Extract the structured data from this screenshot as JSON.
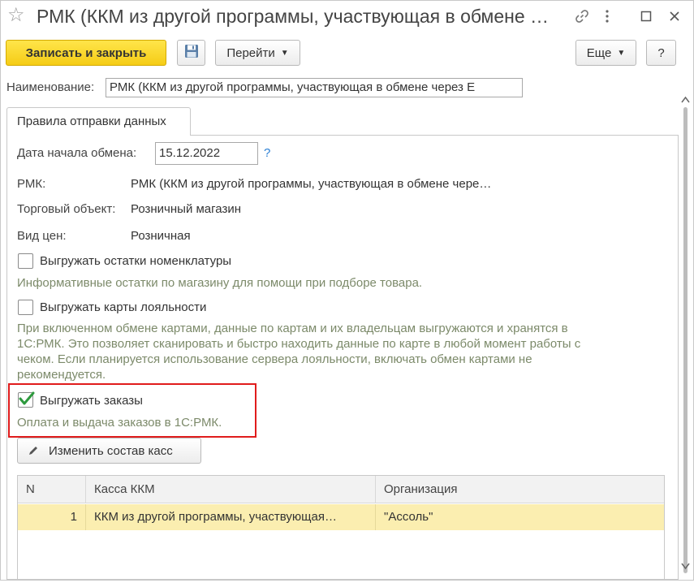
{
  "window": {
    "title": "РМК (ККМ из другой программы, участвующая в обмене ча…"
  },
  "toolbar": {
    "save_close_label": "Записать и закрыть",
    "goto_label": "Перейти",
    "more_label": "Еще",
    "help_label": "?"
  },
  "name_field": {
    "label": "Наименование:",
    "value": "РМК (ККМ из другой программы, участвующая в обмене через Е"
  },
  "tabs": [
    {
      "label": "Правила отправки данных"
    }
  ],
  "form": {
    "start_date_label": "Дата начала обмена:",
    "start_date_value": "15.12.2022",
    "help_mark": "?",
    "rmk_label": "РМК:",
    "rmk_value": "РМК (ККМ из другой программы, участвующая в обмене чере…",
    "trade_object_label": "Торговый объект:",
    "trade_object_value": "Розничный магазин",
    "price_type_label": "Вид цен:",
    "price_type_value": "Розничная",
    "export_stock_label": "Выгружать остатки номенклатуры",
    "export_stock_checked": false,
    "export_stock_hint": "Информативные остатки по магазину для помощи при подборе товара.",
    "export_cards_label": "Выгружать карты лояльности",
    "export_cards_checked": false,
    "export_cards_hint_lines": [
      "При включенном обмене картами, данные по картам и их владельцам выгружаются и хранятся в",
      "1С:РМК. Это позволяет сканировать и быстро находить данные по карте в любой момент работы с",
      "чеком. Если планируется использование сервера лояльности, включать обмен картами не",
      "рекомендуется."
    ],
    "export_orders_label": "Выгружать заказы",
    "export_orders_checked": true,
    "export_orders_hint": "Оплата и выдача заказов в 1С:РМК.",
    "change_registers_label": "Изменить состав касс"
  },
  "table": {
    "columns": [
      "N",
      "Касса ККМ",
      "Организация"
    ],
    "rows": [
      {
        "n": "1",
        "register": "ККМ из другой программы, участвующая…",
        "org": "\"Ассоль\""
      }
    ]
  },
  "colors": {
    "primary_button": "#f5cc16",
    "highlight_box": "#e01c1c",
    "selected_row": "#fbeeb0",
    "hint_text": "#7c8a6a",
    "checkmark": "#2e9a3e"
  }
}
